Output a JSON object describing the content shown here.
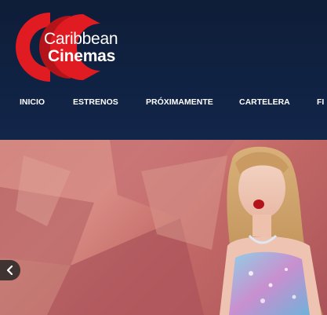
{
  "brand": {
    "line1": "Caribbean",
    "line2": "Cinemas",
    "logo_color": "#e11b22"
  },
  "nav": {
    "items": [
      {
        "label": "INICIO"
      },
      {
        "label": "ESTRENOS"
      },
      {
        "label": "PRÓXIMAMENTE"
      },
      {
        "label": "CARTELERA"
      },
      {
        "label": "FI"
      }
    ]
  },
  "hero": {
    "slide_image": "concert-performer-banner",
    "prev_icon": "chevron-left-icon"
  },
  "colors": {
    "header_bg": "#0e1d38",
    "accent_red": "#e11b22"
  }
}
